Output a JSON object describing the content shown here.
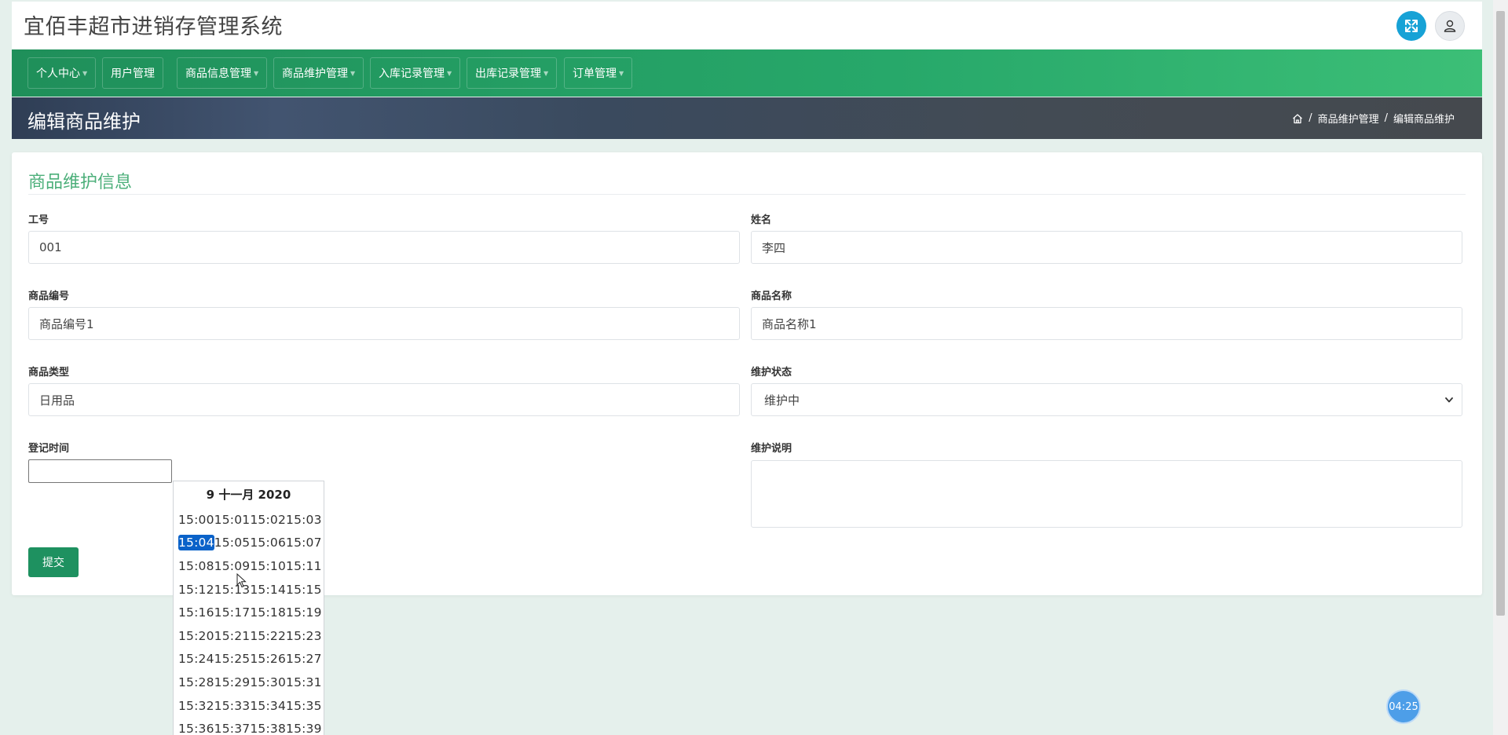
{
  "app": {
    "title": "宜佰丰超市进销存管理系统"
  },
  "nav": {
    "items": [
      {
        "label": "个人中心",
        "dropdown": true
      },
      {
        "label": "用户管理",
        "dropdown": false
      },
      {
        "label": "商品信息管理",
        "dropdown": true
      },
      {
        "label": "商品维护管理",
        "dropdown": true
      },
      {
        "label": "入库记录管理",
        "dropdown": true
      },
      {
        "label": "出库记录管理",
        "dropdown": true
      },
      {
        "label": "订单管理",
        "dropdown": true
      }
    ]
  },
  "page": {
    "title": "编辑商品维护",
    "breadcrumb": [
      "商品维护管理",
      "编辑商品维护"
    ]
  },
  "form": {
    "section_title": "商品维护信息",
    "job_no_label": "工号",
    "job_no_value": "001",
    "name_label": "姓名",
    "name_value": "李四",
    "product_code_label": "商品编号",
    "product_code_value": "商品编号1",
    "product_name_label": "商品名称",
    "product_name_value": "商品名称1",
    "product_type_label": "商品类型",
    "product_type_value": "日用品",
    "status_label": "维护状态",
    "status_value": "维护中",
    "register_time_label": "登记时间",
    "register_time_value": "",
    "note_label": "维护说明",
    "note_value": "",
    "submit_label": "提交"
  },
  "time_picker": {
    "header": "9 十一月 2020",
    "selected": "15:04",
    "rows": [
      [
        "15:00",
        "15:01",
        "15:02",
        "15:03"
      ],
      [
        "15:04",
        "15:05",
        "15:06",
        "15:07"
      ],
      [
        "15:08",
        "15:09",
        "15:10",
        "15:11"
      ],
      [
        "15:12",
        "15:13",
        "15:14",
        "15:15"
      ],
      [
        "15:16",
        "15:17",
        "15:18",
        "15:19"
      ],
      [
        "15:20",
        "15:21",
        "15:22",
        "15:23"
      ],
      [
        "15:24",
        "15:25",
        "15:26",
        "15:27"
      ],
      [
        "15:28",
        "15:29",
        "15:30",
        "15:31"
      ],
      [
        "15:32",
        "15:33",
        "15:34",
        "15:35"
      ],
      [
        "15:36",
        "15:37",
        "15:38",
        "15:39"
      ]
    ]
  },
  "timer": {
    "label": "04:25"
  },
  "colors": {
    "nav_green": "#27a86a",
    "accent_teal": "#17a2d6",
    "section_title": "#4caf7a",
    "submit_button": "#1e9160",
    "picker_selected": "#0a62c9"
  },
  "icons": {
    "fullscreen": "fullscreen-icon",
    "user": "user-icon",
    "home": "home-icon",
    "dropdown": "chevron-down-icon"
  }
}
